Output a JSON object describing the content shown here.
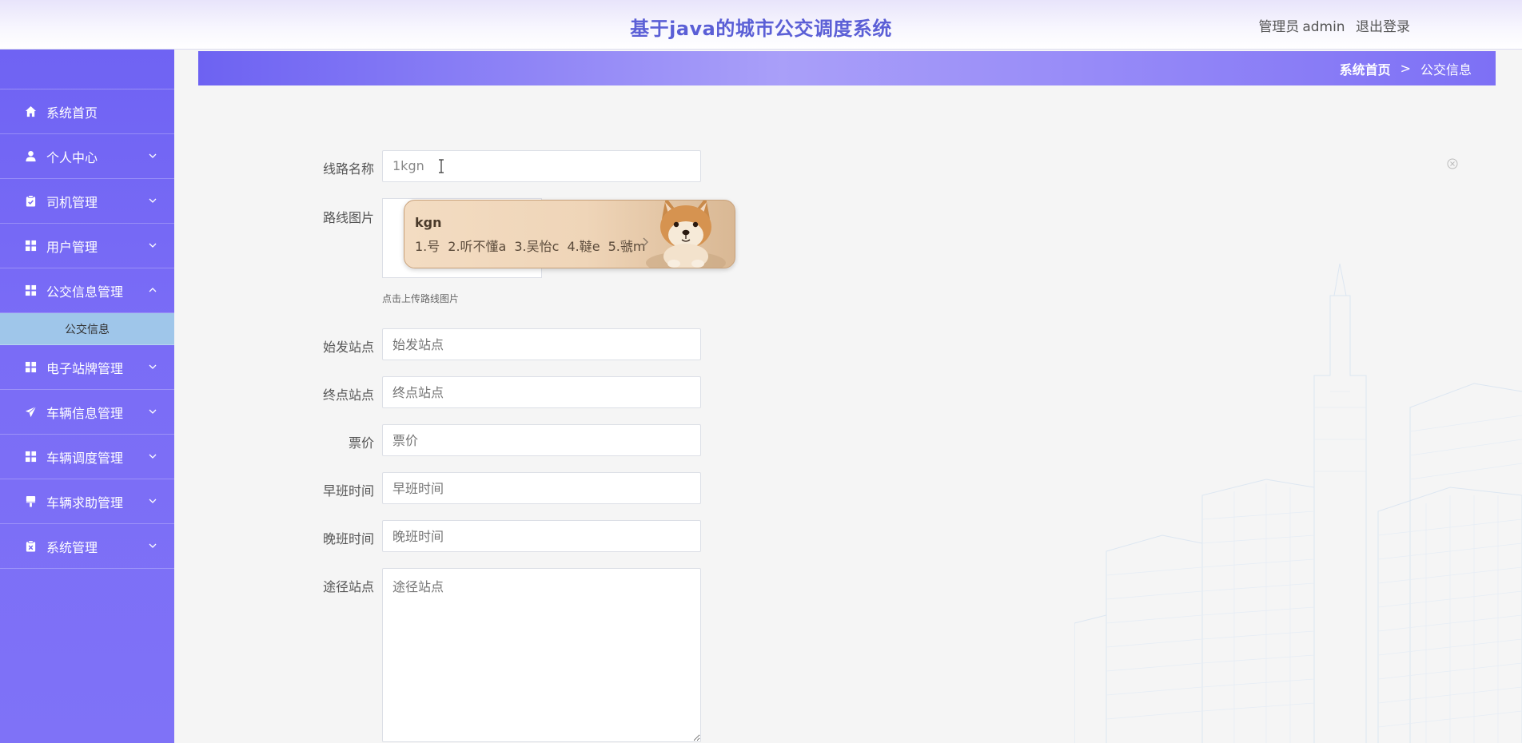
{
  "header": {
    "title": "基于java的城市公交调度系统",
    "user_role": "管理员",
    "user_name": "admin",
    "logout": "退出登录"
  },
  "sidebar": {
    "items": [
      {
        "label": "系统首页",
        "icon": "home-icon"
      },
      {
        "label": "个人中心",
        "icon": "user-icon"
      },
      {
        "label": "司机管理",
        "icon": "clipboard-icon"
      },
      {
        "label": "用户管理",
        "icon": "grid-icon"
      },
      {
        "label": "公交信息管理",
        "icon": "grid-icon",
        "expanded": true,
        "children": [
          {
            "label": "公交信息"
          }
        ]
      },
      {
        "label": "电子站牌管理",
        "icon": "grid-icon"
      },
      {
        "label": "车辆信息管理",
        "icon": "send-icon"
      },
      {
        "label": "车辆调度管理",
        "icon": "grid-icon"
      },
      {
        "label": "车辆求助管理",
        "icon": "brush-icon"
      },
      {
        "label": "系统管理",
        "icon": "clipboard-x-icon"
      }
    ]
  },
  "breadcrumb": {
    "home": "系统首页",
    "separator": ">",
    "current": "公交信息"
  },
  "form": {
    "route_name": {
      "label": "线路名称",
      "value": "1kgn"
    },
    "route_image": {
      "label": "路线图片",
      "tip": "点击上传路线图片"
    },
    "start_station": {
      "label": "始发站点",
      "placeholder": "始发站点"
    },
    "end_station": {
      "label": "终点站点",
      "placeholder": "终点站点"
    },
    "fare": {
      "label": "票价",
      "placeholder": "票价"
    },
    "morning_time": {
      "label": "早班时间",
      "placeholder": "早班时间"
    },
    "evening_time": {
      "label": "晚班时间",
      "placeholder": "晚班时间"
    },
    "via_stations": {
      "label": "途径站点",
      "placeholder": "途径站点"
    }
  },
  "ime": {
    "typed": "kgn",
    "candidates": [
      "1.号",
      "2.听不懂a",
      "3.吴怡c",
      "4.韃e",
      "5.虢m"
    ]
  },
  "colors": {
    "accent": "#5b5fd6",
    "sidebar": "#7467f4",
    "submenu": "#9fc6ea"
  }
}
